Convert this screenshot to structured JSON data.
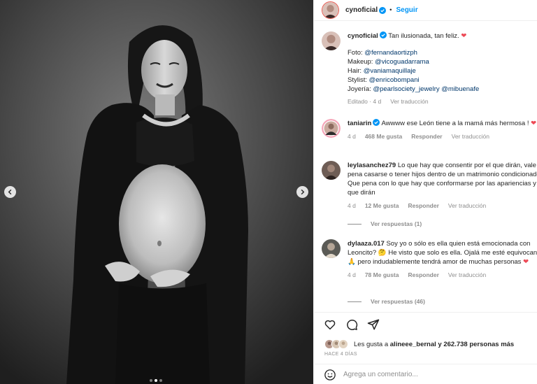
{
  "post": {
    "username": "cynoficial",
    "follow_label": "Seguir",
    "header_separator": "•",
    "caption": {
      "text": "Tan ilusionada, tan feliz.",
      "lines": [
        {
          "label": "Foto:",
          "handles": "@fernandaortizph"
        },
        {
          "label": "Makeup:",
          "handles": "@vicoguadarrama"
        },
        {
          "label": "Hair:",
          "handles": "@vaniamaquillaje"
        },
        {
          "label": "Stylist:",
          "handles": "@enricobompani"
        },
        {
          "label": "Joyería:",
          "handles": "@pearlsociety_jewelry @mibuenafe"
        }
      ],
      "edited": "Editado · 4 d",
      "translate": "Ver traducción"
    },
    "carousel": {
      "dots": 3,
      "active_dot": 1
    }
  },
  "comments": [
    {
      "username": "taniarin",
      "verified": true,
      "text": "Awwww ese León tiene a la mamá más hermosa !",
      "time": "4 d",
      "likes": "468 Me gusta",
      "reply": "Responder",
      "translate": "Ver traducción"
    },
    {
      "username": "leylasanchez79",
      "verified": false,
      "text": "Lo que hay que consentir por el que dirán, vale la pena casarse o tener hijos dentro de un matrimonio condicionado ? Que pena con lo que hay que conformarse por las apariencias y el que dirán",
      "time": "4 d",
      "likes": "12 Me gusta",
      "reply": "Responder",
      "translate": "Ver traducción",
      "view_replies": "Ver respuestas (1)"
    },
    {
      "username": "dylaaza.017",
      "verified": false,
      "text_1": "Soy yo o sólo es ella quien está emocionada con Leoncito?",
      "text_2": "He visto que solo es ella. Ojalá me esté equivocando",
      "text_3": "pero indudablemente tendrá amor de muchas personas",
      "time": "4 d",
      "likes": "78 Me gusta",
      "reply": "Responder",
      "translate": "Ver traducción",
      "view_replies": "Ver respuestas (46)"
    }
  ],
  "actions": {
    "likes_prefix": "Les gusta a",
    "likes_user": "alineee_bernal",
    "likes_suffix": "y 262.738 personas más",
    "timestamp": "HACE 4 DÍAS",
    "comment_placeholder": "Agrega un comentario..."
  },
  "colors": {
    "accent": "#0095f6",
    "link": "#00376b",
    "heart": "#ed4956",
    "muted": "#8e8e8e",
    "verified": "#0095f6"
  },
  "icons": [
    "heart-icon",
    "comment-icon",
    "share-icon",
    "emoji-icon",
    "verified-badge-icon",
    "chevron-left-icon",
    "chevron-right-icon"
  ]
}
